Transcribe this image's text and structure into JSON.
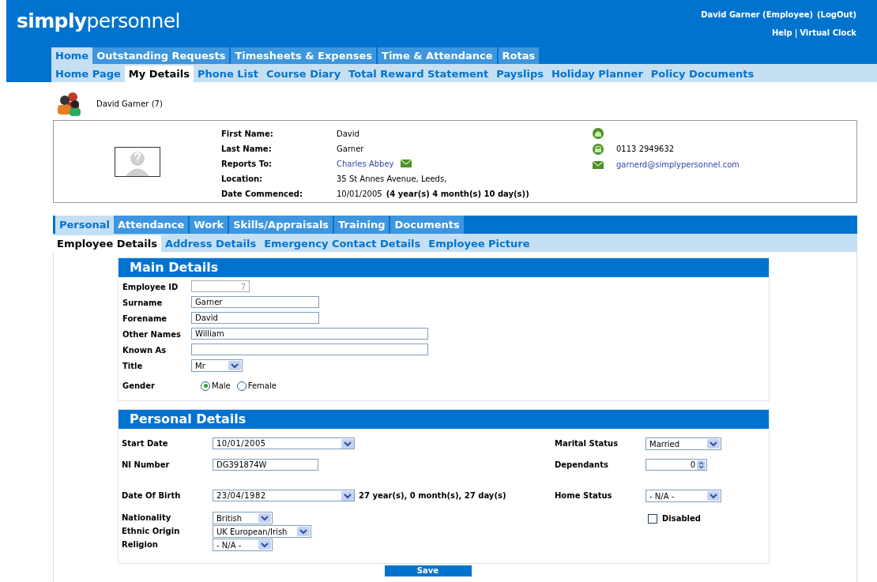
{
  "header": {
    "logo_bold": "simply",
    "logo_light": "personnel",
    "user": "David Garner (Employee)",
    "logout": "(LogOut)",
    "links": [
      "Help",
      "Virtual Clock"
    ],
    "link_separator": "|"
  },
  "main_tabs": [
    {
      "label": "Home",
      "selected": true
    },
    {
      "label": "Outstanding Requests",
      "selected": false
    },
    {
      "label": "Timesheets & Expenses",
      "selected": false
    },
    {
      "label": "Time & Attendance",
      "selected": false
    },
    {
      "label": "Rotas",
      "selected": false
    }
  ],
  "sub_tabs": [
    {
      "label": "Home Page",
      "selected": false
    },
    {
      "label": "My Details",
      "selected": true
    },
    {
      "label": "Phone List",
      "selected": false
    },
    {
      "label": "Course Diary",
      "selected": false
    },
    {
      "label": "Total Reward Statement",
      "selected": false
    },
    {
      "label": "Payslips",
      "selected": false
    },
    {
      "label": "Holiday Planner",
      "selected": false
    },
    {
      "label": "Policy Documents",
      "selected": false
    }
  ],
  "employee": {
    "name": "David Garner (7)"
  },
  "details": [
    {
      "label": "First Name:",
      "value": "David",
      "kind": "text"
    },
    {
      "label": "Last Name:",
      "value": "Garner",
      "kind": "text"
    },
    {
      "label": "Reports To:",
      "value": "Charles Abbey",
      "kind": "link_mail"
    },
    {
      "label": "Location:",
      "value": "35 St Annes Avenue, Leeds,",
      "kind": "text"
    },
    {
      "label": "Date Commenced:",
      "value": "10/01/2005",
      "extra": "(4 year(s) 4 month(s) 10 day(s))",
      "kind": "text"
    }
  ],
  "contacts": [
    {
      "kind": "home"
    },
    {
      "kind": "phone",
      "text": "0113 2949632"
    },
    {
      "kind": "email",
      "text": "garnerd@simplypersonnel.com"
    }
  ],
  "section_tabs": [
    {
      "label": "Personal",
      "selected": true
    },
    {
      "label": "Attendance",
      "selected": false
    },
    {
      "label": "Work",
      "selected": false
    },
    {
      "label": "Skills/Appraisals",
      "selected": false
    },
    {
      "label": "Training",
      "selected": false
    },
    {
      "label": "Documents",
      "selected": false
    }
  ],
  "section_subtabs": [
    {
      "label": "Employee Details",
      "selected": true
    },
    {
      "label": "Address Details",
      "selected": false
    },
    {
      "label": "Emergency Contact Details",
      "selected": false
    },
    {
      "label": "Employee Picture",
      "selected": false
    }
  ],
  "main_details": {
    "title": "Main Details",
    "fields": [
      {
        "label": "Employee ID",
        "kind": "readonly",
        "value": "7"
      },
      {
        "label": "Surname",
        "kind": "text",
        "value": "Garner"
      },
      {
        "label": "Forename",
        "kind": "text",
        "value": "David"
      },
      {
        "label": "Other Names",
        "kind": "text_wide",
        "value": "William"
      },
      {
        "label": "Known As",
        "kind": "text_wide"
      },
      {
        "label": "Title",
        "kind": "select",
        "value": "Mr"
      },
      {
        "label": "Gender",
        "kind": "radio",
        "options": [
          {
            "label": "Male",
            "selected": true
          },
          {
            "label": "Female",
            "selected": false
          }
        ]
      }
    ]
  },
  "personal_details": {
    "title": "Personal Details",
    "left": [
      {
        "label": "Start Date",
        "kind": "date",
        "value": "10/01/2005"
      },
      {
        "label": "NI Number",
        "kind": "text",
        "value": "DG391874W"
      },
      {
        "label": "Date Of Birth",
        "kind": "date",
        "value": "23/04/1982",
        "note": "27 year(s), 0 month(s), 27 day(s)"
      },
      {
        "label": "Nationality",
        "kind": "select",
        "value": "British"
      },
      {
        "label": "Ethnic Origin",
        "kind": "select_wide",
        "value": "UK European/Irish"
      },
      {
        "label": "Religion",
        "kind": "select",
        "value": "- N/A -"
      }
    ],
    "right": [
      {
        "label": "Marital Status",
        "kind": "select",
        "value": "Married"
      },
      {
        "label": "Dependants",
        "kind": "spinner",
        "value": "0"
      },
      {
        "label": "Home Status",
        "kind": "select",
        "value": "- N/A -"
      },
      {
        "label": "Disabled",
        "kind": "checkbox",
        "checked": false
      }
    ]
  },
  "save": "Save"
}
